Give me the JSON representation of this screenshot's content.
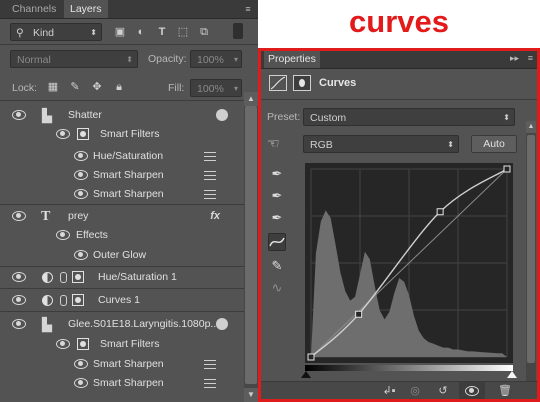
{
  "layers_panel": {
    "tabs": [
      "Channels",
      "Layers"
    ],
    "filter": {
      "kind_label": "Kind"
    },
    "blend_mode": "Normal",
    "opacity": {
      "label": "Opacity:",
      "value": "100%"
    },
    "lock": {
      "label": "Lock:"
    },
    "fill": {
      "label": "Fill:",
      "value": "100%"
    },
    "layers": [
      {
        "name": "Shatter",
        "type": "smart-object"
      },
      {
        "name": "Smart Filters",
        "type": "smart-filters"
      },
      {
        "name": "Hue/Saturation",
        "type": "filter"
      },
      {
        "name": "Smart Sharpen",
        "type": "filter"
      },
      {
        "name": "Smart Sharpen",
        "type": "filter"
      },
      {
        "name": "prey",
        "type": "text",
        "fx": "fx"
      },
      {
        "name": "Effects",
        "type": "effects"
      },
      {
        "name": "Outer Glow",
        "type": "effect"
      },
      {
        "name": "Hue/Saturation 1",
        "type": "adjustment"
      },
      {
        "name": "Curves 1",
        "type": "adjustment"
      },
      {
        "name": "Glee.S01E18.Laryngitis.1080p...",
        "type": "smart-object"
      },
      {
        "name": "Smart Filters",
        "type": "smart-filters"
      },
      {
        "name": "Smart Sharpen",
        "type": "filter"
      },
      {
        "name": "Smart Sharpen",
        "type": "filter"
      }
    ]
  },
  "title": "curves",
  "properties_panel": {
    "tab": "Properties",
    "header": "Curves",
    "preset": {
      "label": "Preset:",
      "value": "Custom"
    },
    "channel": "RGB",
    "auto_button": "Auto",
    "curve": {
      "points": [
        [
          0,
          0
        ],
        [
          62,
          58
        ],
        [
          168,
          197
        ],
        [
          255,
          255
        ]
      ],
      "accent": "#e01b1b"
    }
  },
  "colors": {
    "title": "#e21a1a",
    "panel_bg": "#535353",
    "highlight_border": "#e01b1b"
  }
}
